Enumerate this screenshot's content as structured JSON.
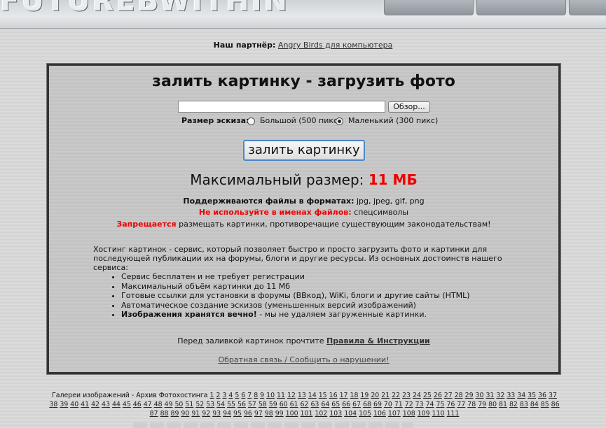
{
  "header": {
    "logo_text": "FUTUREBWITHIN"
  },
  "partner": {
    "label": "Наш партнёр:",
    "link": "Angry Birds для компьютера"
  },
  "upload": {
    "title": "залить картинку - загрузить фото",
    "browse_label": "Обзор...",
    "size_label": "Размер эскиза:",
    "size_options": [
      {
        "label": "Большой (500 пикс)",
        "checked": false
      },
      {
        "label": "Маленький (300 пикс)",
        "checked": true
      }
    ],
    "submit_label": "залить картинку"
  },
  "limits": {
    "max_label": "Максимальный размер:",
    "max_value": "11 МБ",
    "formats_label": "Поддерживаются файлы в форматах:",
    "formats_value": "jpg, jpeg, gif, png",
    "no_special_label": "Не используйте в именах файлов:",
    "no_special_value": "спецсимволы",
    "forbidden_label": "Запрещается",
    "forbidden_value": "размещать картинки, противоречащие существующим законодательствам!"
  },
  "description": "Хостинг картинок - сервис, который позволяет быстро и просто загрузить фото и картинки для последующей публикации их на форумы, блоги и другие ресурсы. Из основных достоинств нашего сервиса:",
  "features": [
    {
      "text": "Сервис бесплатен и не требует регистрации"
    },
    {
      "text": "Максимальный объём картинки до 11 Мб"
    },
    {
      "text": "Готовые ссылки для установки в форумы (BBкод), WiKi, блоги и другие сайты (HTML)"
    },
    {
      "text": "Автоматическое создание эскизов (уменьшенных версий изображений)"
    },
    {
      "bold": "Изображения хранятся вечно!",
      "text": " - мы не удаляем загруженные картинки."
    }
  ],
  "rules": {
    "prefix": "Перед заливкой картинок прочтите",
    "link": "Правила & Инструкции"
  },
  "feedback_link": "Обратная связь / Сообщить о нарушении!",
  "galleries": {
    "label": "Галереи изображений - Архив Фотохостинга",
    "page_count": 111
  },
  "colors": {
    "accent_red": "#e00000",
    "button_border": "#4f86c9"
  }
}
